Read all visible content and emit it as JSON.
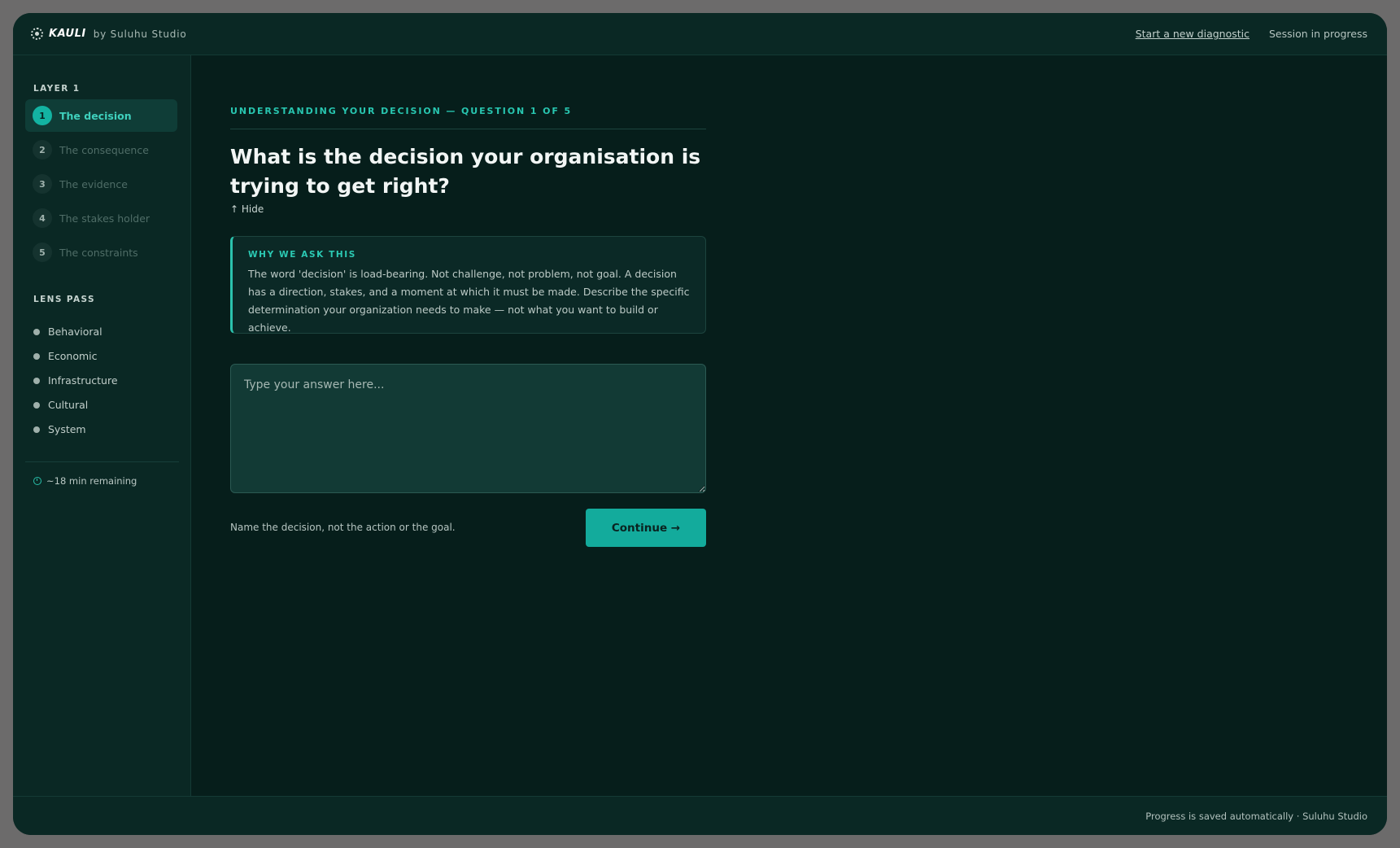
{
  "header": {
    "brand": "KAULI",
    "by_line": "by Suluhu Studio",
    "new_diagnostic_link": "Start a new diagnostic",
    "session_status": "Session in progress"
  },
  "sidebar": {
    "layer_label": "LAYER 1",
    "steps": [
      {
        "num": "1",
        "label": "The decision",
        "active": true
      },
      {
        "num": "2",
        "label": "The consequence",
        "active": false
      },
      {
        "num": "3",
        "label": "The evidence",
        "active": false
      },
      {
        "num": "4",
        "label": "The stakes holder",
        "active": false
      },
      {
        "num": "5",
        "label": "The constraints",
        "active": false
      }
    ],
    "lens_label": "LENS PASS",
    "lenses": [
      "Behavioral",
      "Economic",
      "Infrastructure",
      "Cultural",
      "System"
    ],
    "time_remaining": "~18 min remaining"
  },
  "main": {
    "eyebrow": "UNDERSTANDING YOUR DECISION — QUESTION 1 OF 5",
    "question": "What is the decision your organisation is trying to get right?",
    "hide_toggle": "↑ Hide",
    "why_title": "WHY WE ASK THIS",
    "why_body": "The word 'decision' is load-bearing. Not challenge, not problem, not goal. A decision has a direction, stakes, and a moment at which it must be made. Describe the specific determination your organization needs to make — not what you want to build or achieve.",
    "answer_placeholder": "Type your answer here...",
    "answer_value": "",
    "hint": "Name the decision, not the action or the goal.",
    "continue_label": "Continue →"
  },
  "footer": {
    "text": "Progress is saved automatically · Suluhu Studio"
  },
  "colors": {
    "accent": "#13b3a2",
    "background": "#061e1b",
    "panel": "#0a2824"
  }
}
